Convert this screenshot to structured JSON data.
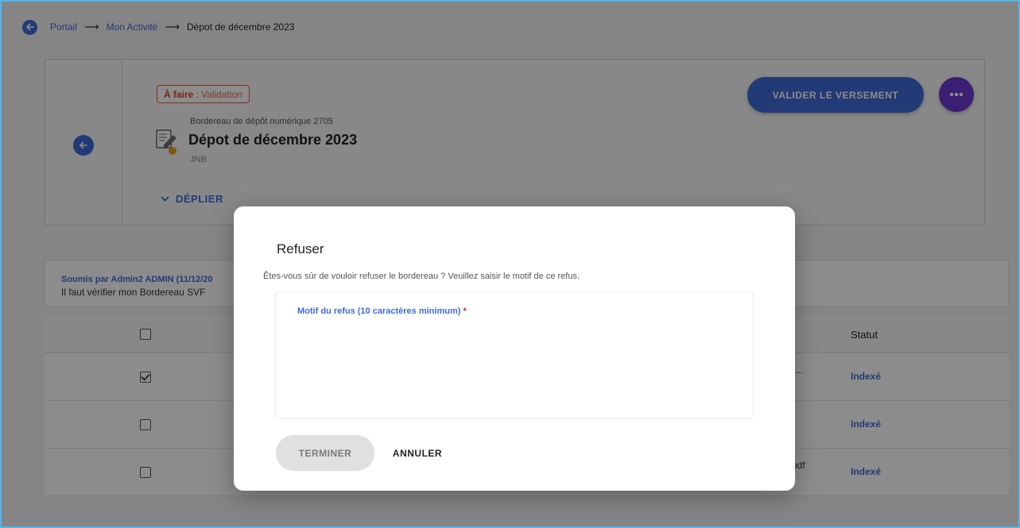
{
  "breadcrumb": {
    "items": [
      "Portail",
      "Mon Activité"
    ],
    "separator": "⟶",
    "current": "Dépot de décembre 2023"
  },
  "header": {
    "status_label": "À faire",
    "status_value": ": Validation",
    "subtitle": "Bordereau de dépôt numérique 2705",
    "title": "Dépot de décembre 2023",
    "owner": "JNB",
    "expand_label": "DÉPLIER",
    "validate_label": "VALIDER LE VERSEMENT"
  },
  "comment": {
    "author": "Soumis par Admin2 ADMIN (11/12/20",
    "text": "Il faut vérifier mon Bordereau SVF"
  },
  "table": {
    "status_header": "Statut",
    "rows": [
      {
        "checked": true,
        "file": "\"...",
        "status": "Indexé"
      },
      {
        "checked": false,
        "file": "",
        "status": "Indexé"
      },
      {
        "checked": false,
        "file": "pdf",
        "status": "Indexé"
      }
    ]
  },
  "dialog": {
    "title": "Refuser",
    "message": "Êtes-vous sûr de vouloir refuser le bordereau ? Veuillez saisir le motif de ce refus.",
    "field_label": "Motif du refus (10 caractères minimum)",
    "field_required": "*",
    "field_value": "",
    "confirm_label": "TERMINER",
    "cancel_label": "ANNULER"
  },
  "colors": {
    "primary": "#3f6ad8",
    "more_button": "#6c3ad1",
    "status_chip": "#d9462a",
    "overlay": "rgba(0,0,0,0.45)"
  },
  "icons": {
    "back": "arrow-left-icon",
    "document": "document-edit-icon",
    "expand": "chevron-down-icon",
    "more": "more-horizontal-icon"
  }
}
